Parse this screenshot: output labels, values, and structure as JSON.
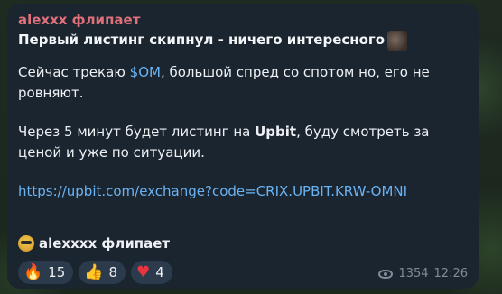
{
  "post": {
    "author": "alexxx флипает",
    "headline": "Первый листинг скипнул - ничего интересного",
    "p1_a": "Сейчас трекаю ",
    "p1_ticker": "$OM",
    "p1_b": ", большой спред со спотом но, его не ровняют.",
    "p2_a": "Через 5 минут будет листинг на ",
    "p2_exchange": "Upbit",
    "p2_b": ", буду смотреть за ценой и уже по ситуации.",
    "link": "https://upbit.com/exchange?code=CRIX.UPBIT.KRW-OMNI",
    "signature": "alexxxx флипает"
  },
  "reactions": [
    {
      "icon": "fire-icon",
      "glyph": "🔥",
      "count": "15"
    },
    {
      "icon": "thumbs-up-icon",
      "glyph": "👍",
      "count": "8"
    },
    {
      "icon": "heart-icon",
      "glyph": "♥",
      "count": "4"
    }
  ],
  "meta": {
    "views": "1354",
    "time": "12:26"
  },
  "colors": {
    "author": "#e0707a",
    "link": "#6ab3f3",
    "bubble": "#1b2530"
  }
}
